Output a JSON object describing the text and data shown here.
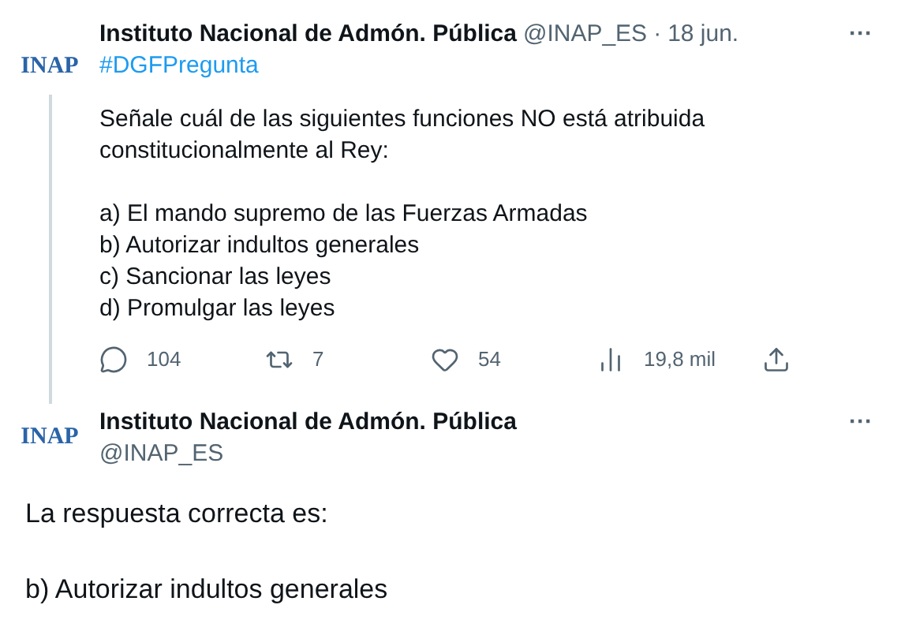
{
  "tweet": {
    "logo": "INAP",
    "name": "Instituto Nacional de Admón. Pública",
    "handle": "@INAP_ES",
    "separator": "·",
    "date": "18 jun.",
    "more": "···",
    "hashtag": "#DGFPregunta",
    "paragraphs": [
      [
        "Señale cuál de las siguientes funciones NO está atribuida constitucionalmente al Rey:"
      ],
      [
        "a) El mando supremo de las Fuerzas Armadas",
        "b) Autorizar indultos generales",
        "c) Sancionar las leyes",
        "d) Promulgar las leyes"
      ]
    ],
    "actions": [
      {
        "kind": "reply",
        "count": "104"
      },
      {
        "kind": "retweet",
        "count": "7"
      },
      {
        "kind": "like",
        "count": "54"
      },
      {
        "kind": "views",
        "count": "19,8 mil"
      },
      {
        "kind": "share"
      }
    ]
  },
  "reply": {
    "logo": "INAP",
    "name": "Instituto Nacional de Admón. Pública",
    "handle": "@INAP_ES",
    "more": "···",
    "paragraphs": [
      [
        "La respuesta correcta es:"
      ],
      [
        "b) Autorizar indultos generales"
      ]
    ]
  }
}
